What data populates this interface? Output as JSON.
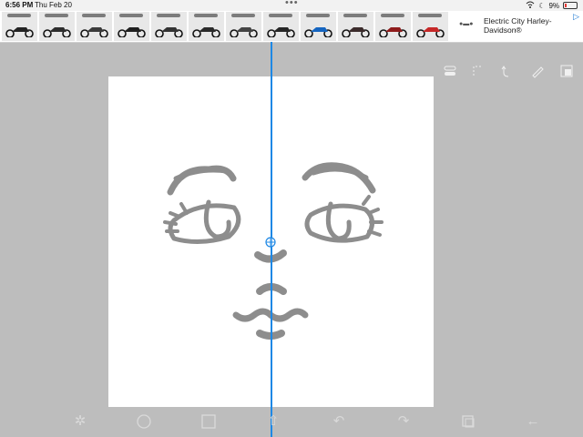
{
  "status_bar": {
    "time": "6:56 PM",
    "date": "Thu Feb 20",
    "multitask_dots": "•••",
    "battery_percent": "9%"
  },
  "ad_banner": {
    "advertiser": "Electric City Harley-Davidson®",
    "thumbnail_count": 12,
    "choices_icon": "triangle-ad-choices-icon"
  },
  "toolbar_top": {
    "icons": [
      "toggle-icon",
      "lasso-icon",
      "redo-curve-icon",
      "pencil-icon",
      "layers-icon"
    ]
  },
  "toolbar_bottom": {
    "icons": [
      "quickmenu-icon",
      "ellipse-icon",
      "rect-icon",
      "transform-icon",
      "undo-icon",
      "redo-icon",
      "copy-icon",
      "back-arrow-icon"
    ]
  },
  "canvas": {
    "symmetry_guide": true,
    "subject": "cartoon face sketch"
  },
  "colors": {
    "workspace": "#bdbdbd",
    "canvas": "#ffffff",
    "guide": "#1e88e5",
    "stroke": "#7a7a7a"
  }
}
